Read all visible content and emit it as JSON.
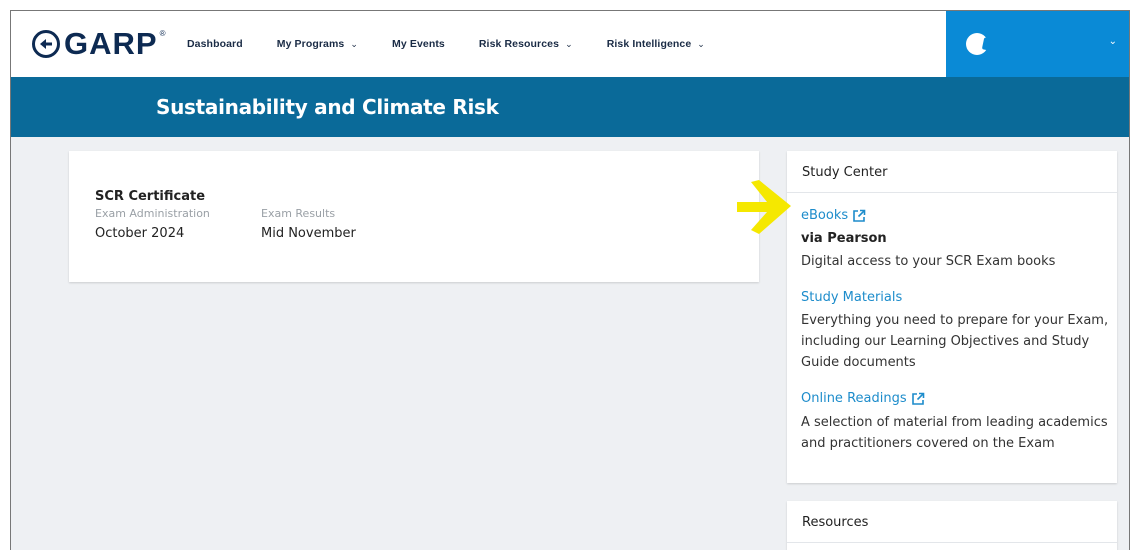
{
  "header": {
    "logo_text": "GARP",
    "logo_reg": "®",
    "nav": [
      {
        "label": "Dashboard",
        "has_dropdown": false
      },
      {
        "label": "My Programs",
        "has_dropdown": true
      },
      {
        "label": "My Events",
        "has_dropdown": false
      },
      {
        "label": "Risk Resources",
        "has_dropdown": true
      },
      {
        "label": "Risk Intelligence",
        "has_dropdown": true
      }
    ],
    "chevron": "⌄"
  },
  "banner": {
    "title": "Sustainability and Climate Risk"
  },
  "certificate": {
    "title": "SCR Certificate",
    "columns": [
      {
        "label": "Exam Administration",
        "value": "October 2024"
      },
      {
        "label": "Exam Results",
        "value": "Mid November"
      }
    ]
  },
  "study_center": {
    "heading": "Study Center",
    "items": [
      {
        "link": "eBooks",
        "external": true,
        "subtitle": "via Pearson",
        "description": "Digital access to your SCR Exam books"
      },
      {
        "link": "Study Materials",
        "external": false,
        "description_lines": [
          "Everything you need to prepare for your Exam,",
          "including our Learning Objectives and Study",
          "Guide documents"
        ]
      },
      {
        "link": "Online Readings",
        "external": true,
        "description_lines": [
          "A selection of material from leading academics",
          "and practitioners covered on the Exam"
        ]
      }
    ]
  },
  "resources": {
    "heading": "Resources"
  },
  "colors": {
    "brand_navy": "#0d2a52",
    "banner_blue": "#0a6a99",
    "user_blue": "#0a8ad6",
    "link_blue": "#1d8ccb",
    "highlight_arrow": "#f5e800"
  },
  "icons": [
    "garp-logo-icon",
    "avatar-icon",
    "chevron-down-icon",
    "external-link-icon",
    "pointer-arrow-icon"
  ]
}
